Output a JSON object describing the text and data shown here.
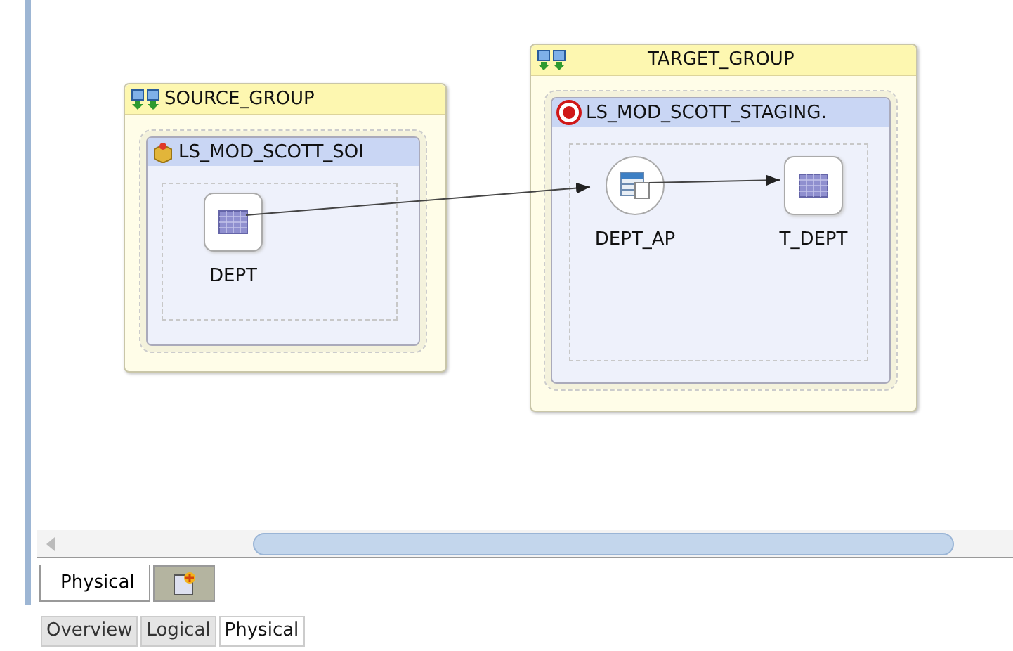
{
  "diagram": {
    "groups": [
      {
        "title": "SOURCE_GROUP",
        "model": {
          "title": "LS_MOD_SCOTT_SOI",
          "kind": "source",
          "nodes": [
            {
              "label": "DEPT",
              "kind": "datastore"
            }
          ]
        }
      },
      {
        "title": "TARGET_GROUP",
        "model": {
          "title": "LS_MOD_SCOTT_STAGING.",
          "kind": "staging",
          "nodes": [
            {
              "label": "DEPT_AP",
              "kind": "access_point"
            },
            {
              "label": "T_DEPT",
              "kind": "datastore"
            }
          ]
        }
      }
    ]
  },
  "editor_tabs": [
    {
      "label": "Physical",
      "selected": true
    }
  ],
  "bottom_tabs": [
    {
      "label": "Overview",
      "selected": false
    },
    {
      "label": "Logical",
      "selected": false
    },
    {
      "label": "Physical",
      "selected": true
    }
  ]
}
